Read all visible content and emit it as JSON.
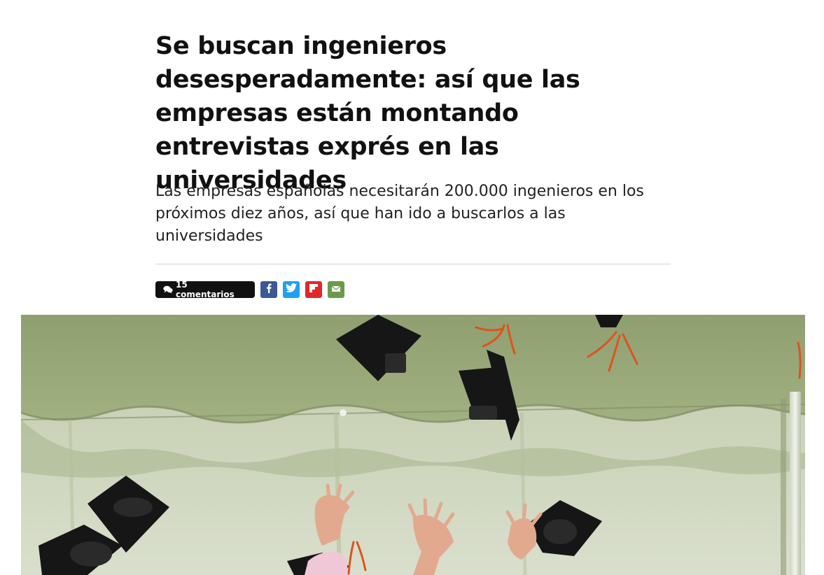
{
  "article": {
    "headline": "Se buscan ingenieros desesperadamente: así que las empresas están montando entrevistas exprés en las universidades",
    "subtitle": "Las empresas españolas necesitarán 200.000 ingenieros en los próximos diez años, así que han ido a buscarlos a las universidades"
  },
  "meta": {
    "comments_label": "15 comentarios",
    "comments_icon": "comments-icon",
    "share": [
      {
        "name": "facebook",
        "icon": "facebook-icon",
        "color": "#3b5998"
      },
      {
        "name": "twitter",
        "icon": "twitter-icon",
        "color": "#1da1f2"
      },
      {
        "name": "flipboard",
        "icon": "flipboard-icon",
        "color": "#e12828"
      },
      {
        "name": "email",
        "icon": "email-icon",
        "color": "#6c9a49"
      }
    ]
  },
  "hero_image": {
    "subject": "graduation caps thrown in the air under a tent",
    "tent_color": "#9fb07e",
    "cap_color": "#141414",
    "tassel_color": "#e0521c"
  }
}
